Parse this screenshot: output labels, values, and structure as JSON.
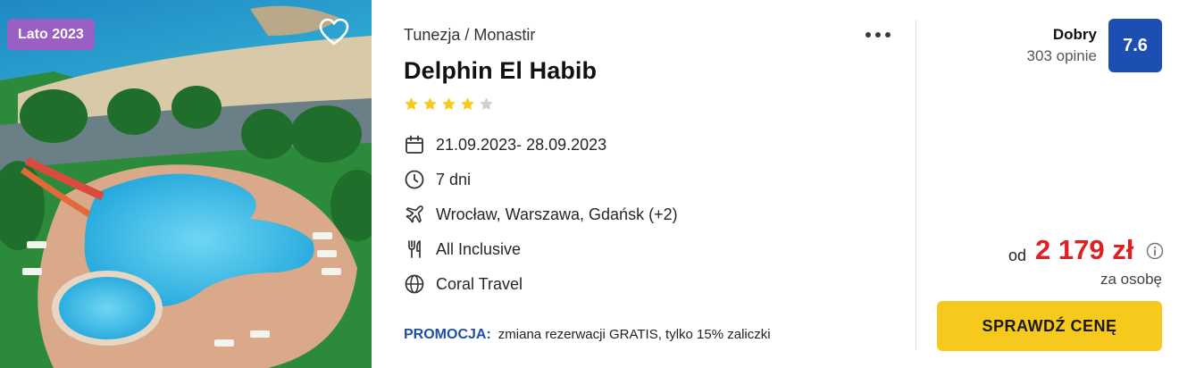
{
  "photo": {
    "season_badge": "Lato 2023",
    "favorite_icon": "heart-icon"
  },
  "offer": {
    "location": "Tunezja / Monastir",
    "more_icon": "more-dots-icon",
    "hotel_name": "Delphin El Habib",
    "stars": {
      "filled": 4,
      "total": 5
    },
    "dates": "21.09.2023- 28.09.2023",
    "length": "7 dni",
    "departures": "Wrocław, Warszawa, Gdańsk  (+2)",
    "board": "All Inclusive",
    "operator": "Coral Travel",
    "promo_label": "PROMOCJA:",
    "promo_text": "zmiana rezerwacji GRATIS, tylko 15% zaliczki",
    "icons": {
      "dates": "calendar-icon",
      "length": "clock-icon",
      "departures": "plane-icon",
      "board": "cutlery-icon",
      "operator": "globe-icon"
    }
  },
  "rating": {
    "label": "Dobry",
    "reviews": "303 opinie",
    "score": "7.6"
  },
  "price": {
    "prefix": "od",
    "value": "2 179 zł",
    "per": "za osobę",
    "info_icon": "info-icon"
  },
  "cta_label": "SPRAWDŹ CENĘ",
  "colors": {
    "season_badge": "#9a5fc4",
    "score_badge": "#1d4fb3",
    "price": "#e02020",
    "cta": "#f6c91c",
    "promo_label": "#1d4fa8",
    "star_filled": "#f6c91c",
    "star_empty": "#cfcfcf"
  }
}
